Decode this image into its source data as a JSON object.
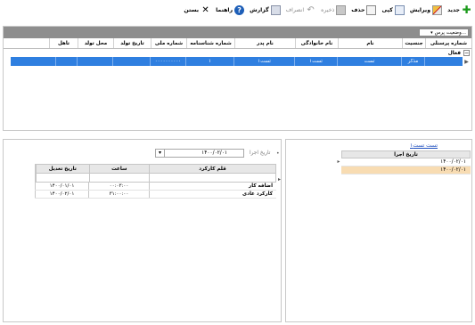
{
  "toolbar": {
    "new": "جدید",
    "edit": "ویرایش",
    "copy": "کپی",
    "delete": "حذف",
    "save": "ذخیره",
    "undo": "انصراف",
    "report": "گزارش",
    "help": "راهنما",
    "close": "بستن"
  },
  "top_panel": {
    "status_filter": "وضعیت پرس...",
    "columns": [
      "شماره پرسنلی",
      "جنسیت",
      "نام",
      "نام خانوادگی",
      "نام پدر",
      "شماره شناسنامه",
      "شماره ملی",
      "تاریخ تولد",
      "محل تولد",
      "تاهل"
    ],
    "group_label": "فعال",
    "rows": [
      [
        "",
        "مذکر",
        "تست",
        "تست۱",
        "تست۱",
        "۱",
        "۰۰۰۰۰۰۰۰۰۰",
        "",
        "",
        ""
      ]
    ]
  },
  "right_panel": {
    "title": "تست تست۱",
    "column": "تاریخ اجرا",
    "rows": [
      "۱۴۰۰/۰۲/۰۱",
      "۱۴۰۰/۰۲/۰۱"
    ]
  },
  "left_panel": {
    "filter_label": "تاریخ اجرا",
    "filter_value": "۱۴۰۰/۰۲/۰۱",
    "columns": [
      "قلم کارکرد",
      "ساعت",
      "تاریخ تعدیل"
    ],
    "rows": [
      [
        "اضافه کار",
        "۰۰:۰۳:۰۰",
        "۱۴۰۰/۰۱/۰۱"
      ],
      [
        "کارکرد عادی",
        "۳۱:۰۰:۰۰",
        "۱۴۰۰/۰۲/۰۱"
      ]
    ]
  }
}
